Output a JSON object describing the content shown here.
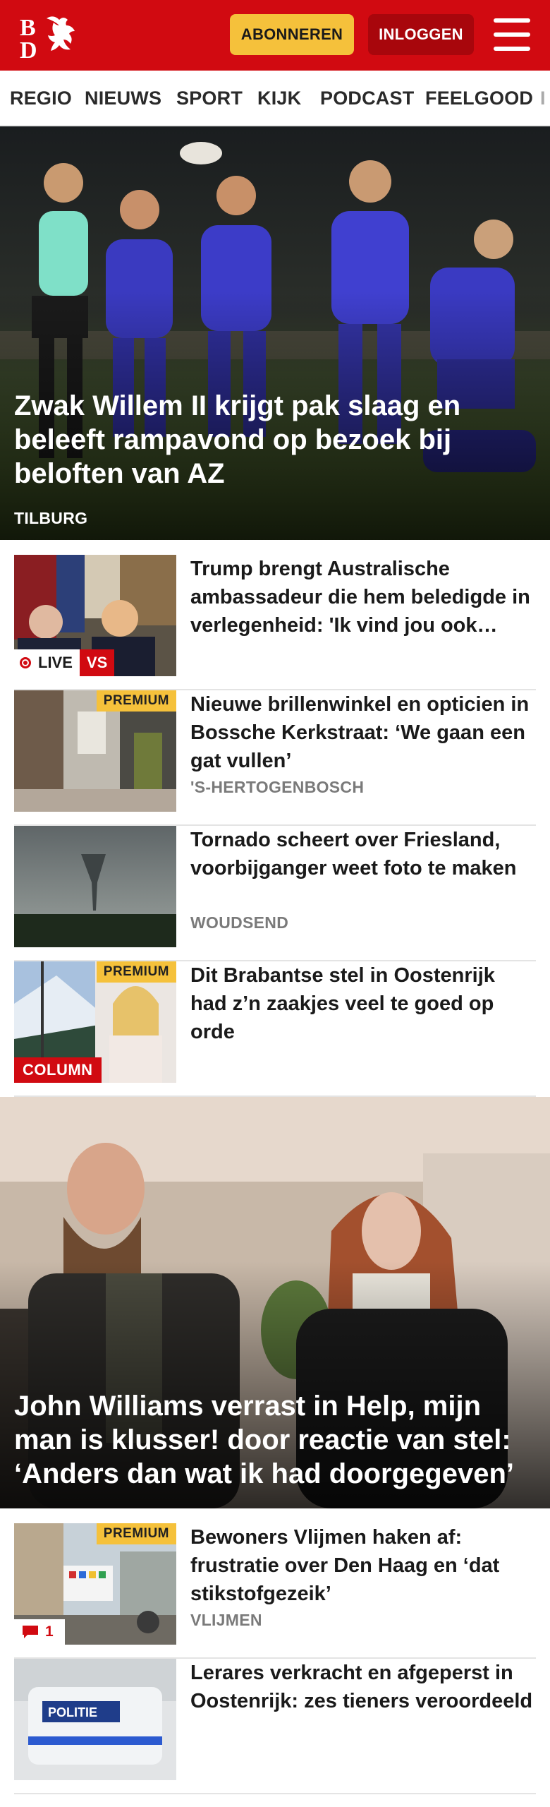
{
  "header": {
    "logo_letters": "BD",
    "subscribe_label": "ABONNEREN",
    "login_label": "INLOGGEN"
  },
  "nav": {
    "items": [
      "REGIO",
      "NIEUWS",
      "SPORT",
      "KIJK",
      "PODCAST",
      "FEELGOOD",
      "I"
    ]
  },
  "hero1": {
    "title": "Zwak Willem II krijgt pak slaag en beleeft rampavond op bezoek bij beloften van AZ",
    "location": "TILBURG"
  },
  "articles": [
    {
      "title": "Trump brengt Australische ambassadeur die hem beledigde in verlegenheid: 'Ik vind jou ook…",
      "location": "",
      "live_label": "LIVE",
      "badge": "VS"
    },
    {
      "title": "Nieuwe brillenwinkel en opticien in Bossche Kerkstraat: ‘We gaan een gat vullen’",
      "location": "'S-HERTOGENBOSCH",
      "premium": "PREMIUM"
    },
    {
      "title": "Tornado scheert over Friesland, voorbijganger weet foto te maken",
      "location": "WOUDSEND"
    },
    {
      "title": "Dit Brabantse stel in Oostenrijk had z’n zaakjes veel te goed op orde",
      "location": "",
      "premium": "PREMIUM",
      "badge": "COLUMN"
    }
  ],
  "hero2": {
    "title": "John Williams verrast in Help, mijn man is klusser! door reactie van stel: ‘Anders dan wat ik had doorgegeven’"
  },
  "articles2": [
    {
      "title": "Bewoners Vlijmen haken af: frustratie over Den Haag en ‘dat stikstofgezeik’",
      "location": "VLIJMEN",
      "premium": "PREMIUM",
      "comment_count": "1"
    },
    {
      "title": "Lerares verkracht en afgeperst in Oostenrijk: zes tieners veroor­deeld",
      "location": ""
    }
  ],
  "colors": {
    "brand_red": "#d10a11",
    "subscribe_yellow": "#f5c13b",
    "login_dark_red": "#a8060c"
  },
  "icons": {
    "menu": "hamburger-menu-icon",
    "comment": "comment-bubble-icon",
    "live": "live-dot-icon"
  }
}
